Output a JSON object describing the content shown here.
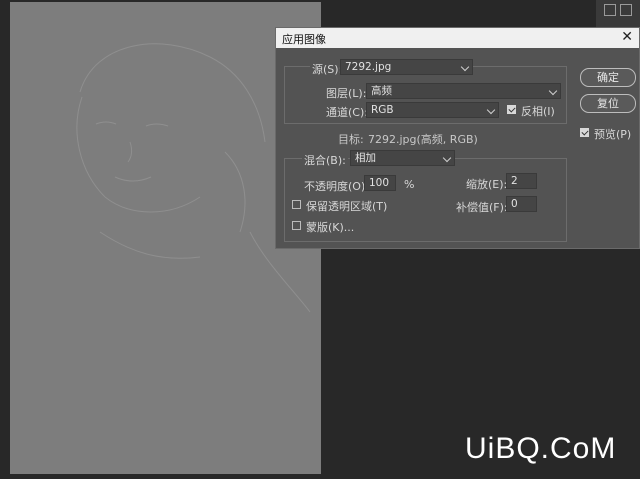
{
  "dialog": {
    "title": "应用图像",
    "close_glyph": "✕",
    "source_label": "源(S):",
    "source_value": "7292.jpg",
    "layer_label": "图层(L):",
    "layer_value": "高频",
    "channel_label": "通道(C):",
    "channel_value": "RGB",
    "invert_label": "反相(I)",
    "invert_checked": true,
    "target_label": "目标:",
    "target_value": "7292.jpg(高频, RGB)",
    "blending_label": "混合(B):",
    "blending_value": "相加",
    "opacity_label": "不透明度(O):",
    "opacity_value": "100",
    "opacity_unit": "%",
    "scale_label": "缩放(E):",
    "scale_value": "2",
    "preserve_label": "保留透明区域(T)",
    "preserve_checked": false,
    "offset_label": "补偿值(F):",
    "offset_value": "0",
    "mask_label": "蒙版(K)...",
    "mask_checked": false,
    "ok_label": "确定",
    "reset_label": "复位",
    "preview_label": "预览(P)",
    "preview_checked": true
  },
  "watermark": "UiBQ.CoM",
  "colors": {
    "canvas": "#7d7d7d",
    "dialog_bg": "#535353",
    "app_bg": "#282828"
  }
}
